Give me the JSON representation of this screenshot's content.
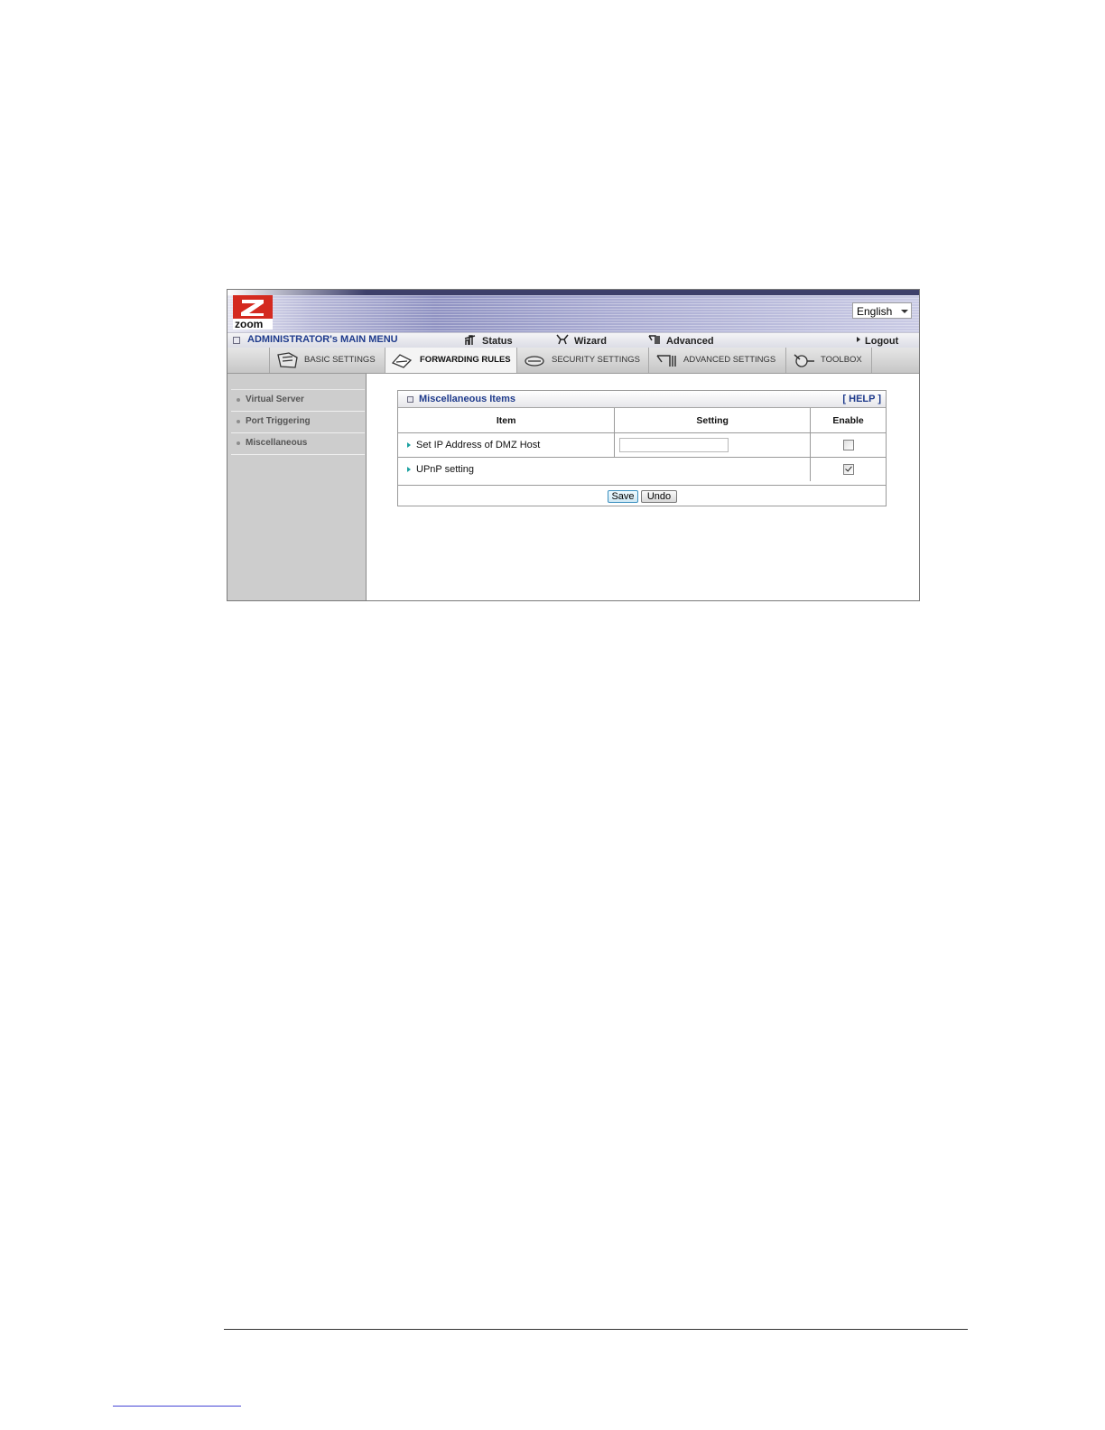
{
  "header": {
    "language": "English",
    "admin_menu": "ADMINISTRATOR's MAIN MENU",
    "menu": [
      {
        "label": "Status",
        "icon": "status-icon"
      },
      {
        "label": "Wizard",
        "icon": "wizard-icon"
      },
      {
        "label": "Advanced",
        "icon": "advanced-icon"
      },
      {
        "label": "Logout",
        "icon": "arrow-right-icon"
      }
    ]
  },
  "tabs": [
    {
      "label": "BASIC SETTINGS",
      "icon": "basic-settings-icon"
    },
    {
      "label": "FORWARDING RULES",
      "icon": "forwarding-rules-icon",
      "active": true
    },
    {
      "label": "SECURITY SETTINGS",
      "icon": "security-settings-icon"
    },
    {
      "label": "ADVANCED SETTINGS",
      "icon": "advanced-settings-icon"
    },
    {
      "label": "TOOLBOX",
      "icon": "toolbox-icon"
    }
  ],
  "sidebar": {
    "items": [
      {
        "label": "Virtual Server"
      },
      {
        "label": "Port Triggering"
      },
      {
        "label": "Miscellaneous"
      }
    ]
  },
  "panel": {
    "title": "Miscellaneous Items",
    "help": "[ HELP ]",
    "columns": [
      "Item",
      "Setting",
      "Enable"
    ],
    "rows": [
      {
        "item": "Set IP Address of DMZ Host",
        "setting_value": "",
        "enabled": false
      },
      {
        "item": "UPnP setting",
        "enabled": true
      }
    ],
    "save_label": "Save",
    "undo_label": "Undo"
  },
  "colors": {
    "header_link": "#1f3b8c",
    "row_marker": "#1aa0a0",
    "logo_red": "#d42a20"
  }
}
